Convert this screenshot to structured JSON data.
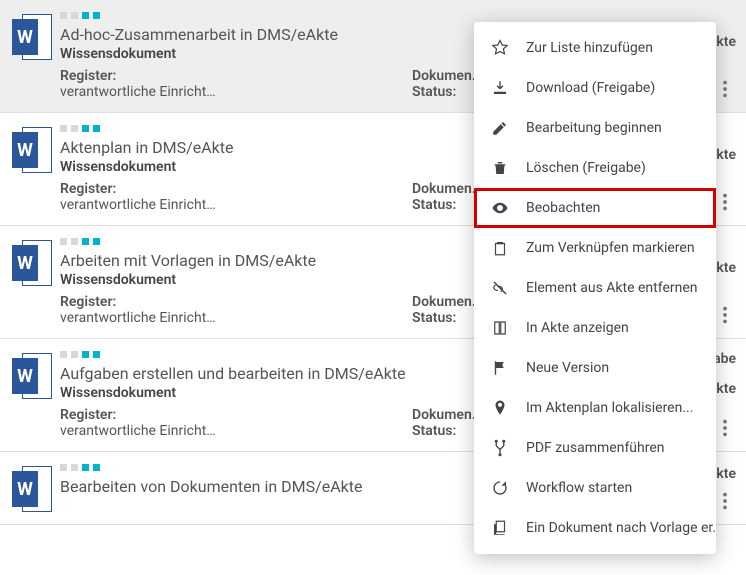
{
  "list": {
    "items": [
      {
        "title": "Ad-hoc-Zusammenarbeit in DMS/eAkte",
        "subtitle": "Wissensdokument",
        "reg_label": "Register:",
        "reg_value": "verantwortliche Einricht…",
        "right_label_1": "Dokumen…",
        "right_label_2": "Status:",
        "short_title": "Ad-hoc-Zusammenarbeit in DMS/eAkte",
        "header": "",
        "selected": true
      },
      {
        "title": "Aktenplan in DMS/eAkte",
        "subtitle": "Wissensdokument",
        "reg_label": "Register:",
        "reg_value": "verantwortliche Einricht…",
        "right_label_1": "Dokumen…",
        "right_label_2": "Status:",
        "short_title": "…kte",
        "header": ""
      },
      {
        "title": "Arbeiten mit Vorlagen in DMS/eAkte",
        "subtitle": "Wissensdokument",
        "reg_label": "Register:",
        "reg_value": "verantwortliche Einricht…",
        "right_label_1": "Dokumen…",
        "right_label_2": "Status:",
        "short_title": "…kte",
        "header": ""
      },
      {
        "title": "Aufgaben erstellen und bearbeiten in DMS/eAkte",
        "subtitle": "Wissensdokument",
        "reg_label": "Register:",
        "reg_value": "verantwortliche Einricht…",
        "right_label_1": "Dokumen…",
        "right_label_2": "Status:",
        "short_title": "…kte",
        "header": "Aufgabe"
      },
      {
        "title": "Bearbeiten von Dokumenten in DMS/eAkte",
        "subtitle": "",
        "reg_label": "",
        "reg_value": "",
        "right_label_1": "",
        "right_label_2": "",
        "short_title": "…kte",
        "header": ""
      }
    ]
  },
  "menu": {
    "items": [
      {
        "label": "Zur Liste hinzufügen",
        "icon": "star"
      },
      {
        "label": "Download (Freigabe)",
        "icon": "download"
      },
      {
        "label": "Bearbeitung beginnen",
        "icon": "edit"
      },
      {
        "label": "Löschen (Freigabe)",
        "icon": "trash"
      },
      {
        "label": "Beobachten",
        "icon": "eye",
        "highlight": true
      },
      {
        "label": "Zum Verknüpfen markieren",
        "icon": "clipboard"
      },
      {
        "label": "Element aus Akte entfernen",
        "icon": "unlink"
      },
      {
        "label": "In Akte anzeigen",
        "icon": "book"
      },
      {
        "label": "Neue Version",
        "icon": "flag"
      },
      {
        "label": "Im Aktenplan lokalisieren...",
        "icon": "pin"
      },
      {
        "label": "PDF zusammenführen",
        "icon": "merge"
      },
      {
        "label": "Workflow starten",
        "icon": "refresh"
      },
      {
        "label": "Ein Dokument nach Vorlage er…",
        "icon": "copy"
      }
    ]
  },
  "icons": {
    "word_letter": "W"
  }
}
